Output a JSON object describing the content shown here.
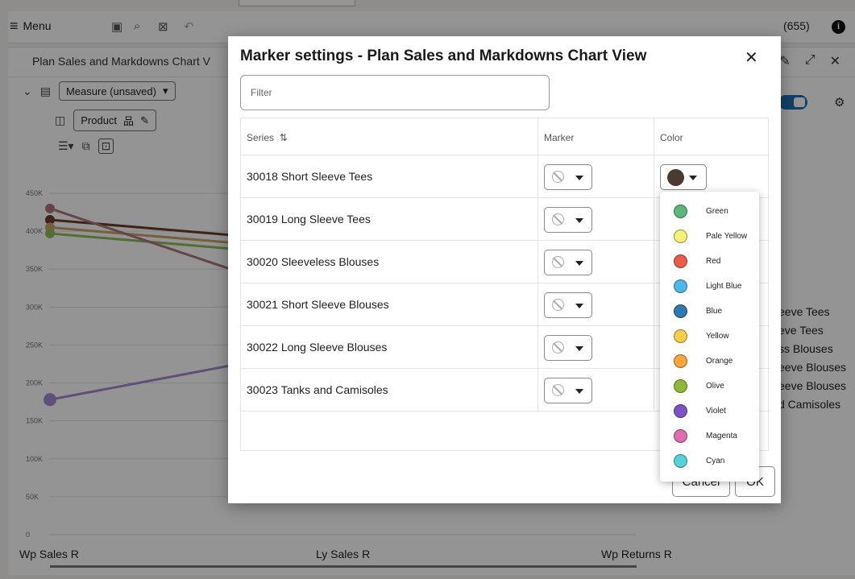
{
  "app": {
    "menu_label": "Menu",
    "count_label": "(655)",
    "info_icon": "info-icon"
  },
  "panel": {
    "title": "Plan Sales and Markdowns Chart V",
    "measure_label": "Measure (unsaved)",
    "product_label": "Product"
  },
  "chart_data": {
    "type": "line",
    "categories": [
      "Wp Sales R",
      "Ly Sales R",
      "Wp Returns R"
    ],
    "y_ticks": [
      "450K",
      "400K",
      "350K",
      "300K",
      "250K",
      "200K",
      "150K",
      "100K",
      "50K",
      "0"
    ],
    "ylim": [
      0,
      450000
    ],
    "legend_visible": [
      "eeve Tees",
      "eve Tees",
      "ss Blouses",
      "eeve Blouses",
      "eeve Blouses",
      "d Camisoles"
    ],
    "series_colors": [
      "#6b3d2a",
      "#c9a46b",
      "#8fbe5a",
      "#b07880",
      "#a58ad0"
    ],
    "start_values": [
      415000,
      405000,
      397000,
      430000,
      178000
    ]
  },
  "dialog": {
    "title": "Marker settings - Plan Sales and Markdowns Chart View",
    "filter_placeholder": "Filter",
    "columns": {
      "series": "Series",
      "series_sort": "⇅",
      "marker": "Marker",
      "color": "Color"
    },
    "rows": [
      {
        "name": "30018 Short Sleeve Tees",
        "color": "#4b3a2e"
      },
      {
        "name": "30019 Long Sleeve Tees"
      },
      {
        "name": "30020 Sleeveless Blouses"
      },
      {
        "name": "30021 Short Sleeve Blouses"
      },
      {
        "name": "30022 Long Sleeve Blouses"
      },
      {
        "name": "30023 Tanks and Camisoles"
      }
    ],
    "cancel_label": "Cancel",
    "ok_label": "OK"
  },
  "color_options": [
    {
      "label": "Green",
      "color": "#5cb77c"
    },
    {
      "label": "Pale Yellow",
      "color": "#f5f07a"
    },
    {
      "label": "Red",
      "color": "#e85d4a"
    },
    {
      "label": "Light Blue",
      "color": "#4fb7e8"
    },
    {
      "label": "Blue",
      "color": "#2f79b0"
    },
    {
      "label": "Yellow",
      "color": "#f5cf4a"
    },
    {
      "label": "Orange",
      "color": "#f7a63e"
    },
    {
      "label": "Olive",
      "color": "#8fb83a"
    },
    {
      "label": "Violet",
      "color": "#7d52c4"
    },
    {
      "label": "Magenta",
      "color": "#df6cb3"
    },
    {
      "label": "Cyan",
      "color": "#56d1db"
    }
  ]
}
